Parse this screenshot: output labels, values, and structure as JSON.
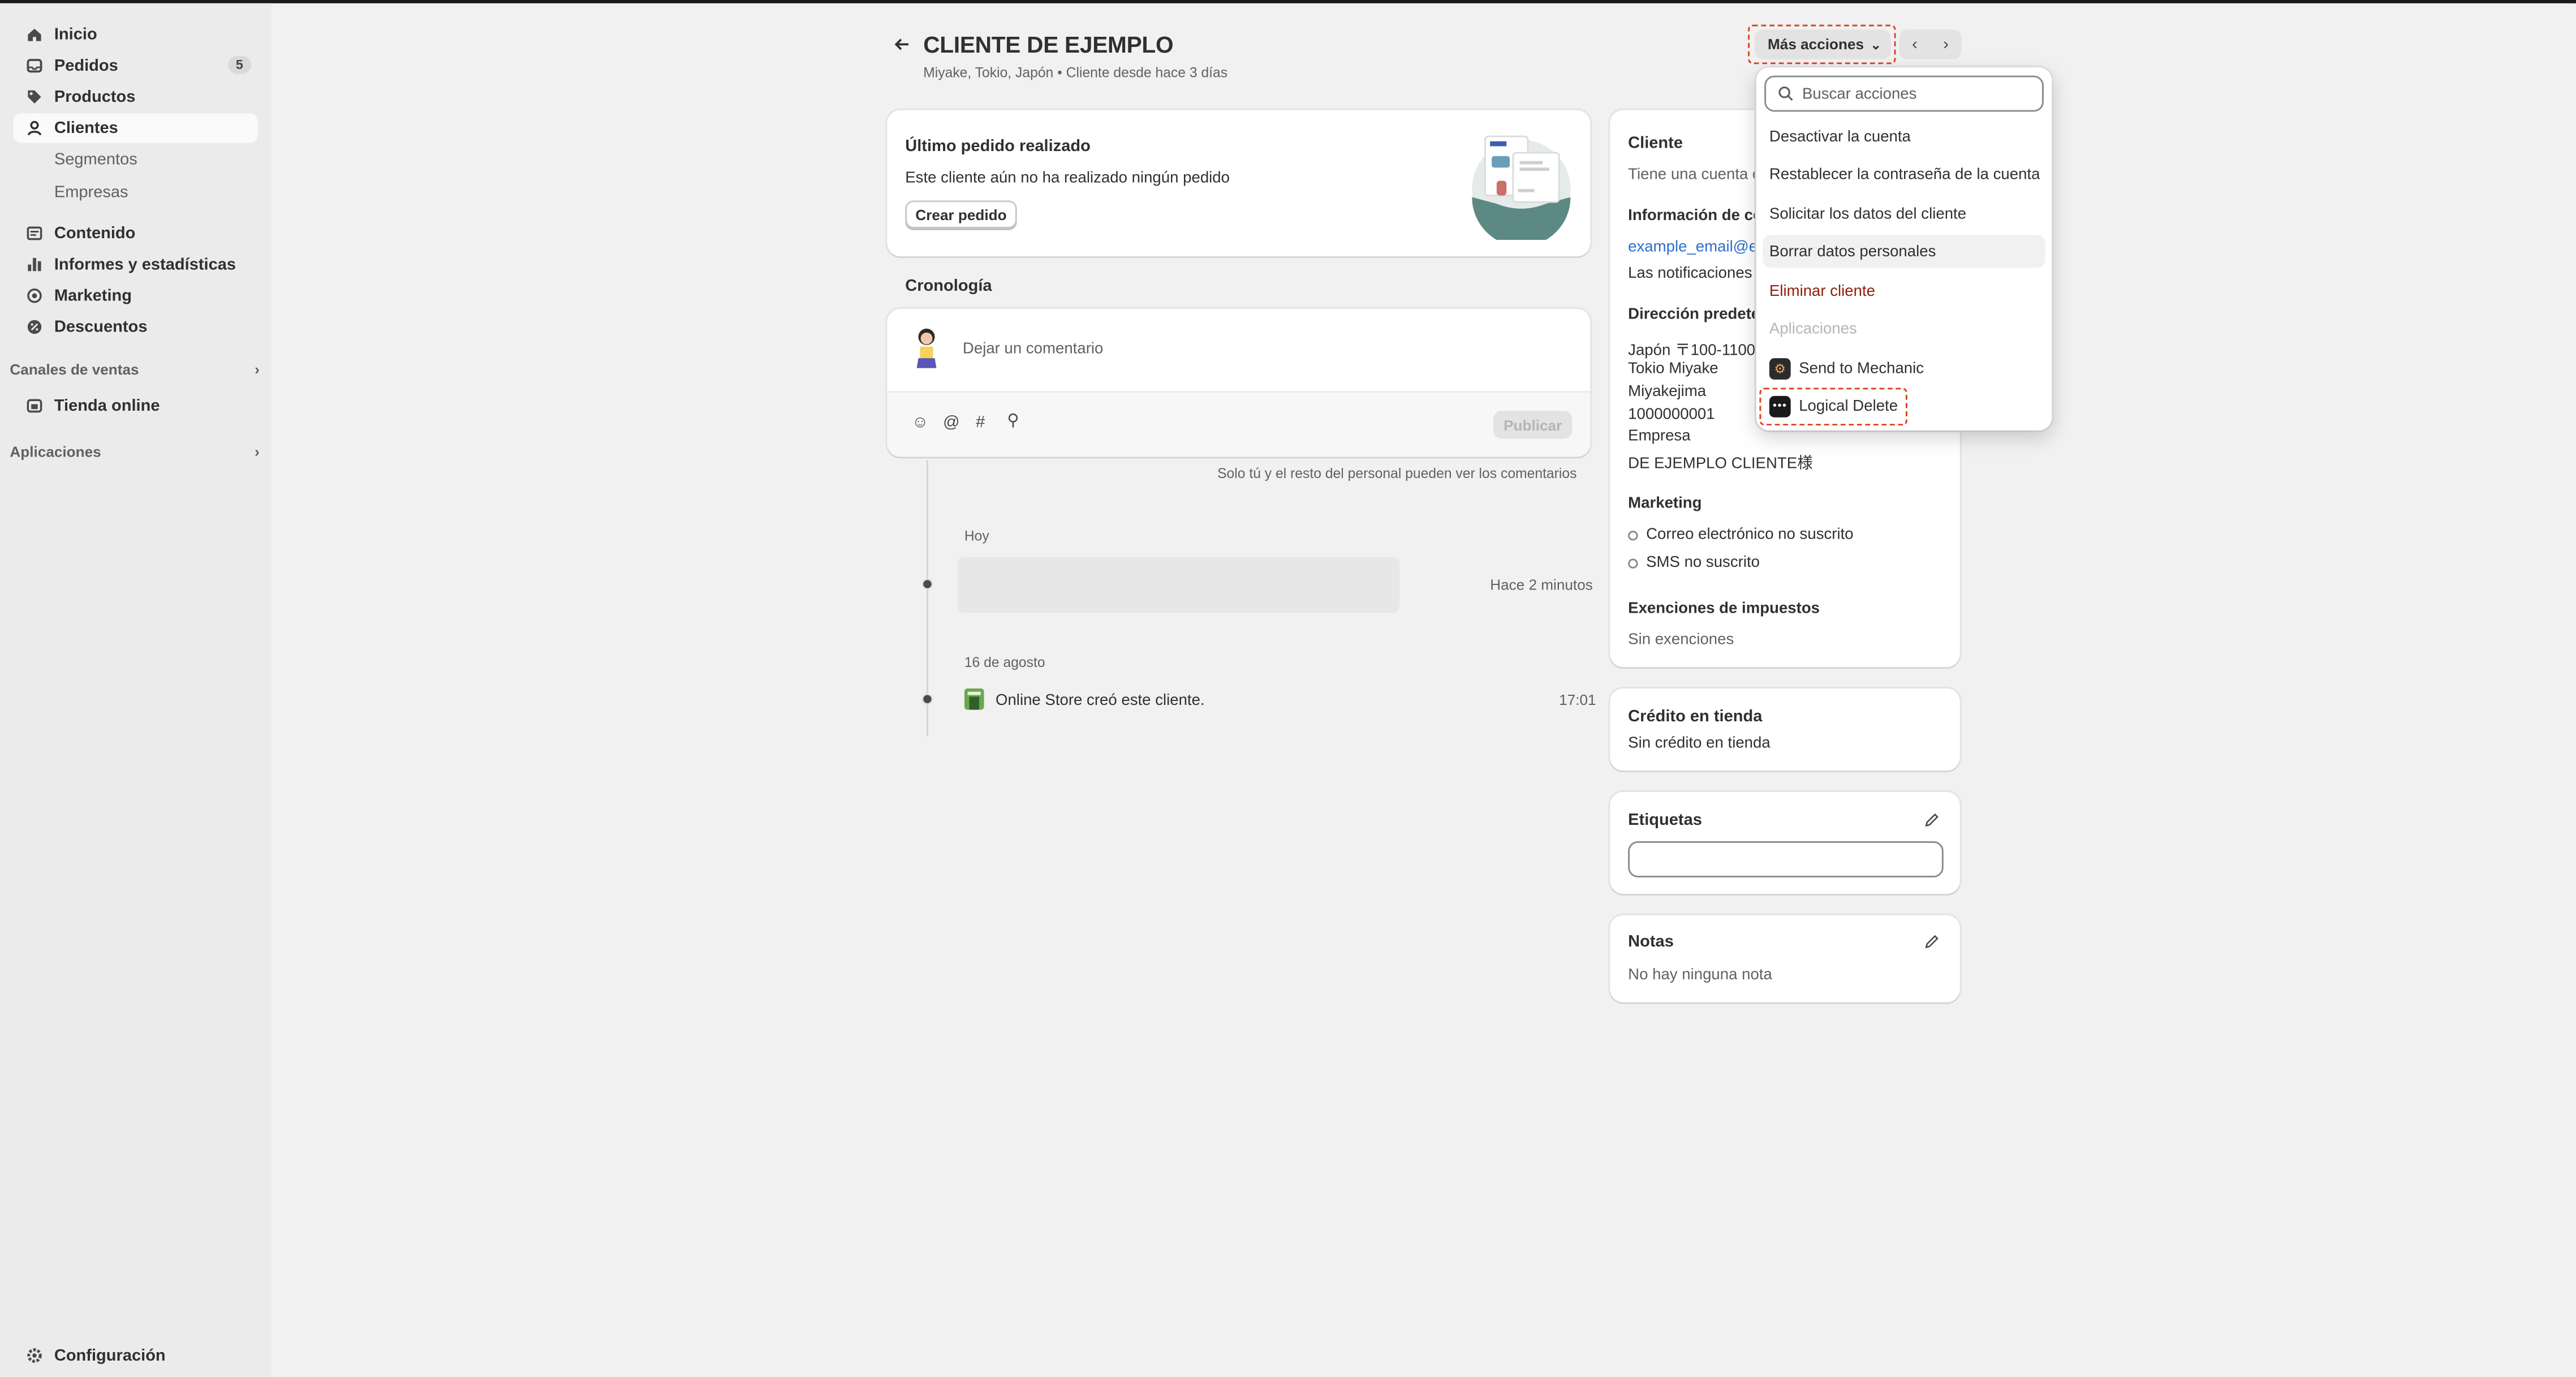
{
  "sidebar": {
    "items": [
      {
        "label": "Inicio",
        "icon": "home-icon"
      },
      {
        "label": "Pedidos",
        "icon": "inbox-icon",
        "badge": "5"
      },
      {
        "label": "Productos",
        "icon": "tag-icon"
      },
      {
        "label": "Clientes",
        "icon": "person-icon"
      },
      {
        "label": "Segmentos"
      },
      {
        "label": "Empresas"
      },
      {
        "label": "Contenido",
        "icon": "content-icon"
      },
      {
        "label": "Informes y estadísticas",
        "icon": "chart-icon"
      },
      {
        "label": "Marketing",
        "icon": "target-icon"
      },
      {
        "label": "Descuentos",
        "icon": "discount-icon"
      }
    ],
    "sales_channels_heading": "Canales de ventas",
    "online_store": "Tienda online",
    "apps_heading": "Aplicaciones",
    "settings": "Configuración"
  },
  "header": {
    "title": "CLIENTE DE EJEMPLO",
    "subtitle": "Miyake, Tokio, Japón • Cliente desde hace 3 días",
    "more_actions": "Más acciones"
  },
  "last_order": {
    "title": "Último pedido realizado",
    "text": "Este cliente aún no ha realizado ningún pedido",
    "button": "Crear pedido"
  },
  "timeline": {
    "title": "Cronología",
    "comment_placeholder": "Dejar un comentario",
    "publish": "Publicar",
    "privacy_note": "Solo tú y el resto del personal pueden ver los comentarios",
    "today": "Hoy",
    "event1_time": "Hace 2 minutos",
    "date2": "16 de agosto",
    "event2_text": "Online Store creó este cliente.",
    "event2_time": "17:01"
  },
  "customer": {
    "title": "Cliente",
    "account_status": "Tiene una cuenta d",
    "contact_heading": "Información de co",
    "email": "example_email@e",
    "notifications": "Las notificaciones",
    "address_heading": "Dirección predete",
    "address_lines": [
      "Japón 〒100-1100",
      "Tokio Miyake",
      "Miyakejima",
      "1000000001",
      "Empresa",
      "DE EJEMPLO CLIENTE様"
    ],
    "marketing_heading": "Marketing",
    "email_marketing": "Correo electrónico no suscrito",
    "sms_marketing": "SMS no suscrito",
    "tax_heading": "Exenciones de impuestos",
    "tax_value": "Sin exenciones"
  },
  "store_credit": {
    "title": "Crédito en tienda",
    "value": "Sin crédito en tienda"
  },
  "tags": {
    "title": "Etiquetas"
  },
  "notes": {
    "title": "Notas",
    "value": "No hay ninguna nota"
  },
  "dropdown": {
    "search_placeholder": "Buscar acciones",
    "items": [
      "Desactivar la cuenta",
      "Restablecer la contraseña de la cuenta",
      "Solicitar los datos del cliente",
      "Borrar datos personales",
      "Eliminar cliente"
    ],
    "apps_heading": "Aplicaciones",
    "apps": [
      "Send to Mechanic",
      "Logical Delete"
    ]
  },
  "colors": {
    "highlight_dash": "#d9411e",
    "danger": "#8e1f0b",
    "link": "#2c6ecb"
  }
}
